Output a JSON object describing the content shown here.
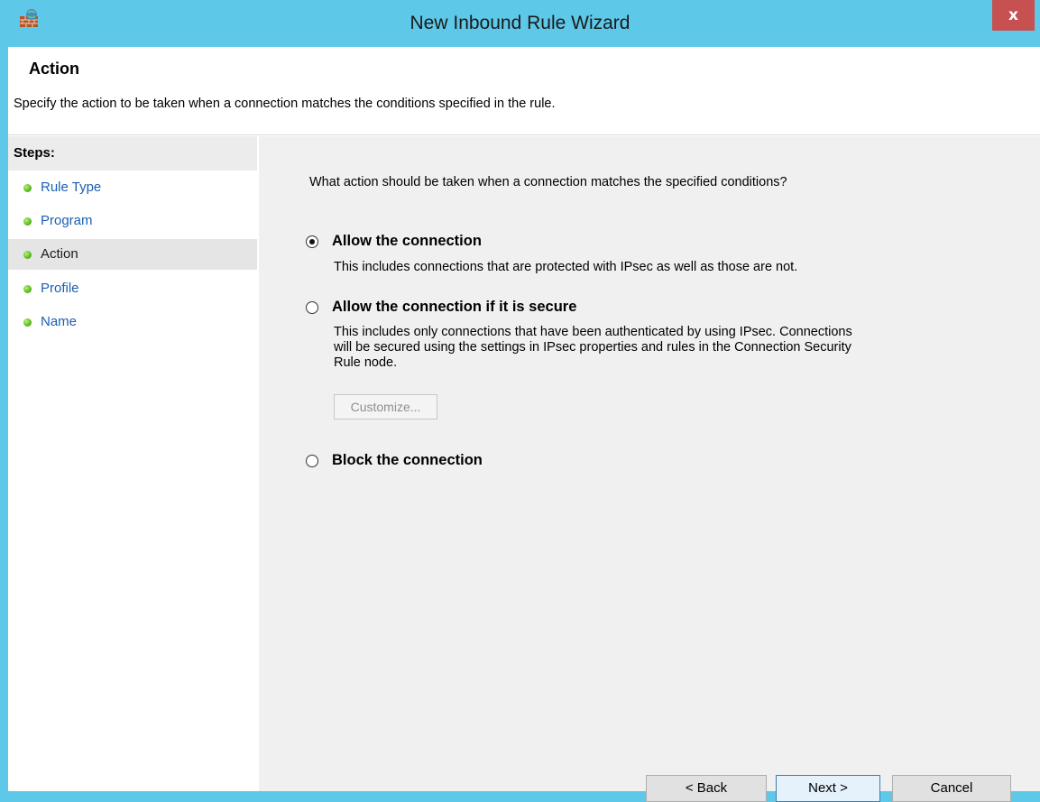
{
  "window": {
    "title": "New Inbound Rule Wizard",
    "close_label": "x",
    "app_icon": "firewall-icon"
  },
  "header": {
    "title": "Action",
    "description": "Specify the action to be taken when a connection matches the conditions specified in the rule."
  },
  "steps": {
    "heading": "Steps:",
    "items": [
      {
        "label": "Rule Type",
        "current": false
      },
      {
        "label": "Program",
        "current": false
      },
      {
        "label": "Action",
        "current": true
      },
      {
        "label": "Profile",
        "current": false
      },
      {
        "label": "Name",
        "current": false
      }
    ]
  },
  "main": {
    "question": "What action should be taken when a connection matches the specified conditions?",
    "options": [
      {
        "label": "Allow the connection",
        "checked": true,
        "description": "This includes connections that are protected with IPsec as well as those are not."
      },
      {
        "label": "Allow the connection if it is secure",
        "checked": false,
        "description_lines": [
          "This includes only connections that have been authenticated by using IPsec.  Connections",
          "will be secured using the settings in IPsec properties and rules in the Connection Security",
          "Rule node."
        ]
      },
      {
        "label": "Block the connection",
        "checked": false
      }
    ],
    "customize_label": "Customize..."
  },
  "footer": {
    "back_label": "< Back",
    "next_label": "Next >",
    "cancel_label": "Cancel"
  },
  "colors": {
    "titlebar": "#5ec8e8",
    "close": "#c75050",
    "step_link": "#1a5fb4",
    "step_dot": "#5fbf23"
  }
}
